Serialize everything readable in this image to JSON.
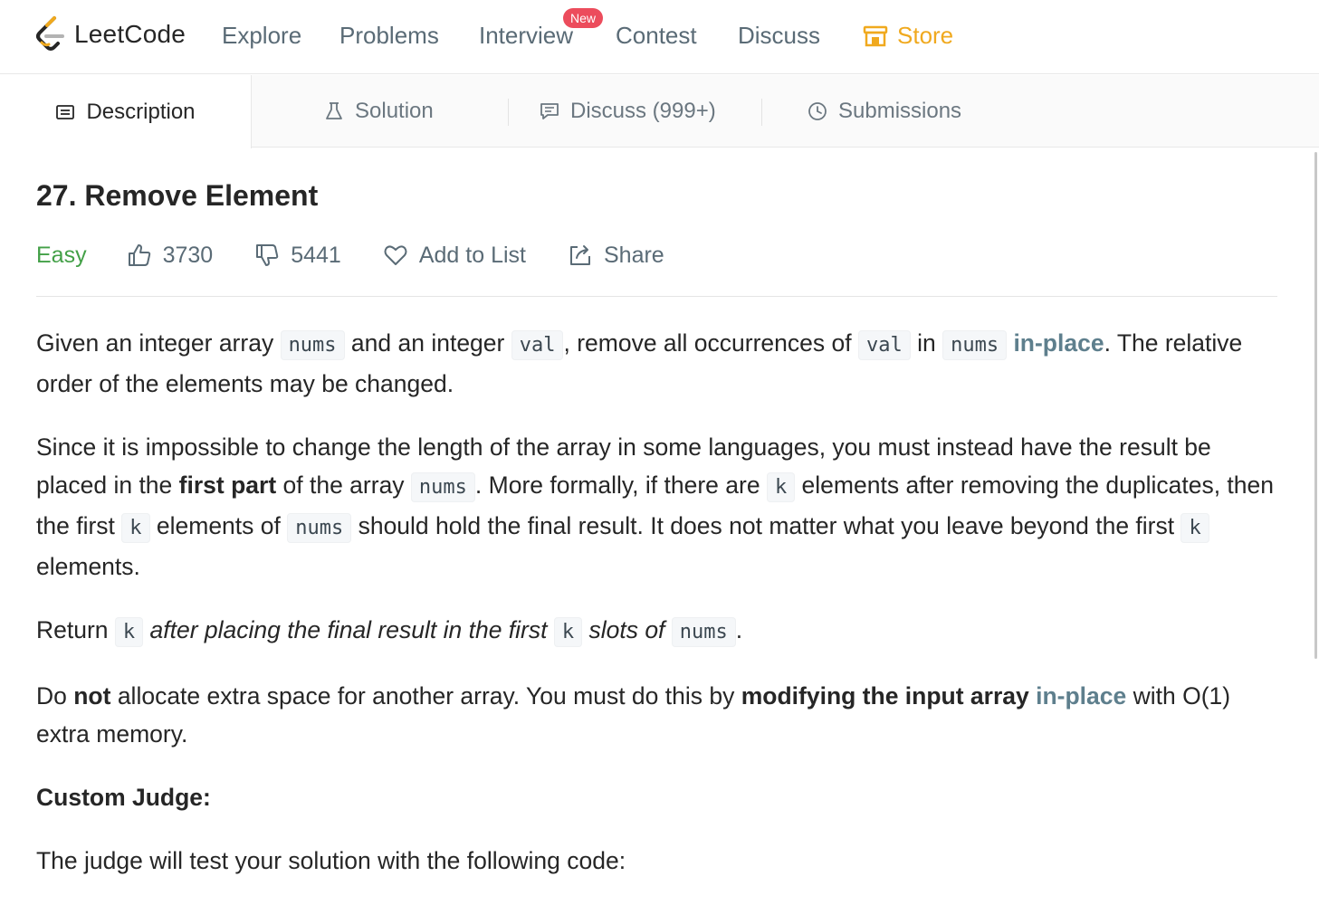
{
  "nav": {
    "logo_text": "LeetCode",
    "items": [
      "Explore",
      "Problems",
      "Interview",
      "Contest",
      "Discuss"
    ],
    "new_badge": "New",
    "store": "Store"
  },
  "tabs": {
    "description": "Description",
    "solution": "Solution",
    "discuss": "Discuss (999+)",
    "submissions": "Submissions"
  },
  "problem": {
    "title": "27. Remove Element",
    "difficulty": "Easy",
    "likes": "3730",
    "dislikes": "5441",
    "add_to_list": "Add to List",
    "share": "Share"
  },
  "description": {
    "p1": [
      "Given an integer array ",
      "nums",
      " and an integer ",
      "val",
      ", remove all occurrences of ",
      "val",
      " in ",
      "nums",
      " ",
      "in-place",
      ". The relative order of the elements may be changed."
    ],
    "p2": [
      "Since it is impossible to change the length of the array in some languages, you must instead have the result be placed in the ",
      "first part",
      " of the array ",
      "nums",
      ". More formally, if there are ",
      "k",
      " elements after removing the duplicates, then the first ",
      "k",
      " elements of ",
      "nums",
      " should hold the final result. It does not matter what you leave beyond the first ",
      "k",
      " elements."
    ],
    "p3": [
      "Return ",
      "k",
      " after placing the final result in the first ",
      "k",
      " slots of ",
      "nums",
      "."
    ],
    "p4": [
      "Do ",
      "not",
      " allocate extra space for another array. You must do this by ",
      "modifying the input array",
      " ",
      "in-place",
      " with O(1) extra memory."
    ],
    "heading": "Custom Judge:",
    "p5": "The judge will test your solution with the following code:"
  },
  "colors": {
    "accent_store": "#f0a91e",
    "easy": "#43a047",
    "badge": "#ec4c5c",
    "link": "#5e7f8d"
  }
}
